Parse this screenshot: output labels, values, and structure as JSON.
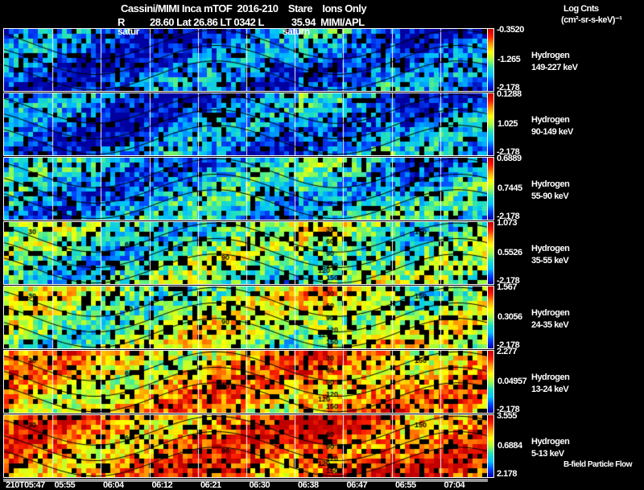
{
  "header": {
    "line1": "Cassini/MIMI Inca mTOF  2016-210    Stare    Ions Only",
    "line2": "R          28.60 Lat 26.86 LT 0342 L           35.94  MIMI/APL",
    "overlay_labels": [
      "satur",
      "saturn"
    ]
  },
  "colorbar_title": {
    "line1": "Log Cnts",
    "line2": "(cm²-sr-s-keV)⁻¹"
  },
  "footer_note": "B-field Particle Flow",
  "chart_data": {
    "type": "heatmap",
    "x_ticks": [
      "210T05:47",
      "05:55",
      "06:04",
      "06:12",
      "06:21",
      "06:30",
      "06:38",
      "06:47",
      "06:55",
      "07:04"
    ],
    "contour_labels": [
      "30",
      "60",
      "90",
      "120",
      "150"
    ],
    "panels": [
      {
        "species": "Hydrogen",
        "energy": "149-227 keV",
        "cmax": "-0.3520",
        "cmid": "-1.265",
        "cmin": "-2.178",
        "level": 0.12
      },
      {
        "species": "Hydrogen",
        "energy": "90-149 keV",
        "cmax": "0.1288",
        "cmid": "1.025",
        "cmin": "-2.178",
        "level": 0.15
      },
      {
        "species": "Hydrogen",
        "energy": "55-90 keV",
        "cmax": "0.6889",
        "cmid": "0.7445",
        "cmin": "-2.178",
        "level": 0.25
      },
      {
        "species": "Hydrogen",
        "energy": "35-55 keV",
        "cmax": "1.073",
        "cmid": "0.5526",
        "cmin": "-2.178",
        "level": 0.4
      },
      {
        "species": "Hydrogen",
        "energy": "24-35 keV",
        "cmax": "1.567",
        "cmid": "0.3056",
        "cmin": "-2.178",
        "level": 0.5
      },
      {
        "species": "Hydrogen",
        "energy": "13-24 keV",
        "cmax": "2.277",
        "cmid": "0.04957",
        "cmin": "-2.178",
        "level": 0.7
      },
      {
        "species": "Hydrogen",
        "energy": "5-13 keV",
        "cmax": "3.555",
        "cmid": "0.6884",
        "cmin": "2.178",
        "level": 0.8
      }
    ]
  }
}
